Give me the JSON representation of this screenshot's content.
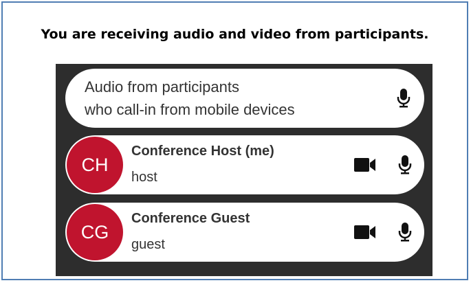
{
  "heading": "You are receiving audio and video from participants.",
  "audio_row": {
    "line1": "Audio from participants",
    "line2": "who call-in from mobile devices",
    "icon": "microphone-icon"
  },
  "participants": [
    {
      "initials": "CH",
      "name": "Conference Host (me)",
      "role": "host",
      "icons": [
        "video-camera-icon",
        "microphone-icon"
      ]
    },
    {
      "initials": "CG",
      "name": "Conference Guest",
      "role": "guest",
      "icons": [
        "video-camera-icon",
        "microphone-icon"
      ]
    }
  ],
  "colors": {
    "avatar": "#c0142e",
    "panel": "#2d2d2d",
    "frame_border": "#4f7db3"
  }
}
